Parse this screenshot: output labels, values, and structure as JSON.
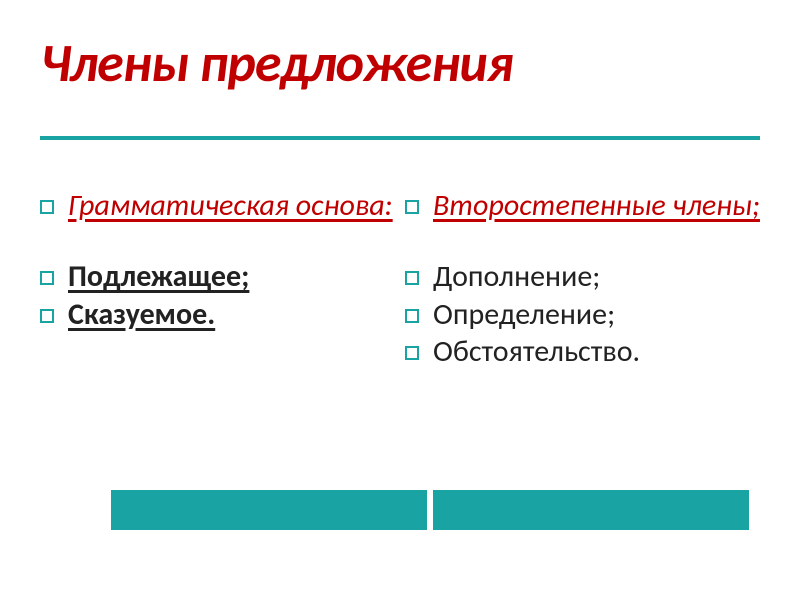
{
  "title": "Члены предложения",
  "left": {
    "header": "Грамматическая основа:",
    "items": [
      "Подлежащее;",
      "Сказуемое."
    ]
  },
  "right": {
    "header": "Второстепенные члены;",
    "items": [
      "Дополнение;",
      "Определение;",
      "Обстоятельство."
    ]
  }
}
